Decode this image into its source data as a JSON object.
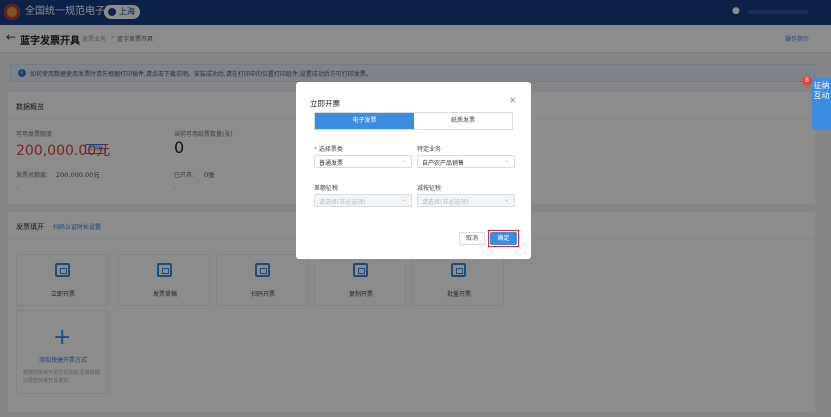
{
  "header": {
    "site_title": "全国统一规范电子税务局",
    "region": "上海",
    "user_icon": "user-icon"
  },
  "subheader": {
    "back_icon": "arrow-left-icon",
    "title": "蓝字发票开具",
    "breadcrumb": [
      "发票业务",
      "蓝字发票开具"
    ],
    "breadcrumb_sep": ">",
    "guide_link": "操作指引"
  },
  "notice": {
    "text": "如何使用数据使用发票时请先根据打印插件,请点击下载说明。安装成功后,请在打印中的位置打印组件,设置成功后方可打印发票。"
  },
  "overview": {
    "title": "数据概览",
    "available_label": "可用发票额度",
    "available_value": "200,000.00元",
    "adjust_tag": "去调整",
    "paper_label": "当前可用纸票数量(张)",
    "paper_value": "0",
    "total_label": "发票总额度:",
    "total_value": "200,000.00元",
    "issued_label": "已开具:",
    "issued_value": "0张",
    "dash": "-"
  },
  "invoice_section": {
    "title": "发票填开",
    "link": "扫码认证时长设置",
    "tiles": [
      {
        "label": "立即开票",
        "icon": "issue-invoice-icon"
      },
      {
        "label": "发票草稿",
        "icon": "draft-icon"
      },
      {
        "label": "扫码开票",
        "icon": "scan-icon"
      },
      {
        "label": "复制开票",
        "icon": "copy-icon"
      },
      {
        "label": "批量开票",
        "icon": "batch-icon"
      }
    ],
    "add_label": "添加快捷开票方式",
    "add_desc": "根据您常用开票方式添加,生成快捷,以便您快速开具发票。"
  },
  "side_tab": {
    "label": "征纳互动",
    "badge": "8"
  },
  "modal": {
    "title": "立即开票",
    "close": "×",
    "tab_electronic": "电子发票",
    "tab_paper": "纸质发票",
    "field_type_required": "*",
    "field_type_label": "选择票类",
    "field_type_value": "普通发票",
    "field_business_label": "特定业务",
    "field_business_value": "自产农产品销售",
    "field_diff_label": "差额征税",
    "field_diff_placeholder": "请选择(非必选项)",
    "field_reduce_label": "减按征税",
    "field_reduce_placeholder": "请选择(非必选项)",
    "cancel": "取消",
    "confirm": "确定",
    "chevron": "⌄"
  },
  "colors": {
    "accent": "#3a8de0",
    "header": "#1a3e85",
    "highlight": "#e02a2a",
    "amount": "#e2463a"
  }
}
